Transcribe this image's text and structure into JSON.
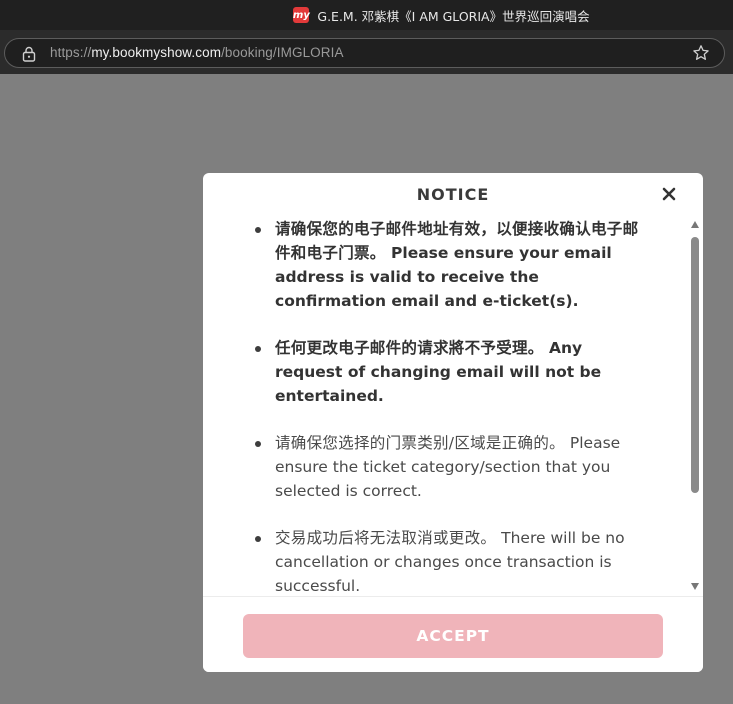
{
  "window": {
    "tab_icon": "my",
    "title": "G.E.M. 邓紫棋《I AM GLORIA》世界巡回演唱会"
  },
  "address_bar": {
    "scheme": "https://",
    "domain": "my.bookmyshow.com",
    "path": "/booking/IMGLORIA"
  },
  "modal": {
    "title": "NOTICE",
    "items": [
      {
        "zh": "请确保您的电子邮件地址有效，以便接收确认电子邮件和电子门票。",
        "en": "Please ensure your email address is valid to receive the confirmation email and e-ticket(s).",
        "bold": true
      },
      {
        "zh": "任何更改电子邮件的请求將不予受理。",
        "en": "Any request of changing email will not be entertained.",
        "bold": true
      },
      {
        "zh": "请确保您选择的门票类别/区域是正确的。",
        "en": "Please ensure the ticket category/section that you selected is correct.",
        "bold": false
      },
      {
        "zh": "交易成功后将无法取消或更改。",
        "en": "There will be no cancellation or changes once transaction is successful.",
        "bold": false
      }
    ],
    "accept_label": "ACCEPT"
  },
  "colors": {
    "overlay": "#7f7f7f",
    "accept_button": "#f0b4ba",
    "brand_icon": "#e23a3a"
  },
  "icons": {
    "lock": "lock-icon",
    "star": "star-icon",
    "close": "close-icon"
  }
}
